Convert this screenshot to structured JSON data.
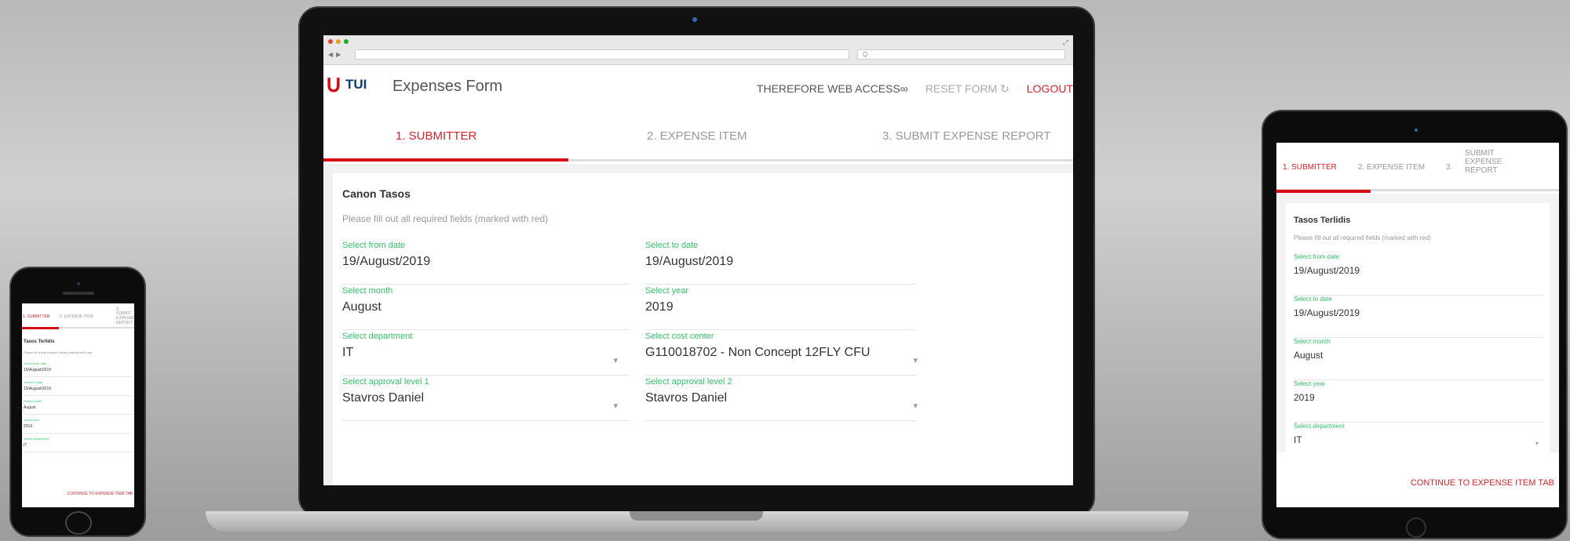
{
  "app": {
    "logo_text": "TUI",
    "title": "Expenses Form"
  },
  "header_links": {
    "web_access": "THEREFORE WEB ACCESS",
    "reset_form": "RESET FORM",
    "logout": "LOGOUT"
  },
  "browser": {
    "search_placeholder": "Q"
  },
  "steps": [
    {
      "label": "1. SUBMITTER",
      "active": true
    },
    {
      "label": "2. EXPENSE ITEM",
      "active": false
    },
    {
      "label": "3. SUBMIT EXPENSE REPORT",
      "active": false
    }
  ],
  "laptop_form": {
    "submitter_name": "Canon Tasos",
    "instructions": "Please fill out all required fields (marked with red)",
    "fields": [
      {
        "label": "Select from date",
        "value": "19/August/2019"
      },
      {
        "label": "Select to date",
        "value": "19/August/2019"
      },
      {
        "label": "Select month",
        "value": "August"
      },
      {
        "label": "Select year",
        "value": "2019"
      },
      {
        "label": "Select department",
        "value": "IT"
      },
      {
        "label": "Select cost center",
        "value": "G110018702 - Non Concept 12FLY CFU"
      },
      {
        "label": "Select approval level 1",
        "value": "Stavros Daniel"
      },
      {
        "label": "Select approval level 2",
        "value": "Stavros Daniel"
      }
    ]
  },
  "tablet_form": {
    "step1": "1. SUBMITTER",
    "step2": "2. EXPENSE ITEM",
    "step3_num": "3.",
    "step3_label": "SUBMIT EXPENSE REPORT",
    "submitter_name": "Tasos Terlidis",
    "instructions": "Please fill out all required fields (marked with red)",
    "fields": [
      {
        "label": "Select from date",
        "value": "19/August/2019"
      },
      {
        "label": "Select to date",
        "value": "19/August/2019"
      },
      {
        "label": "Select month",
        "value": "August"
      },
      {
        "label": "Select year",
        "value": "2019"
      },
      {
        "label": "Select department",
        "value": "IT"
      }
    ],
    "continue_button": "CONTINUE TO EXPENSE ITEM TAB"
  },
  "phone_form": {
    "step1": "1. SUBMITTER",
    "step2": "2. EXPENSE ITEM",
    "step3": "3. SUBMIT EXPENSE REPORT",
    "submitter_name": "Tasos Terlidis",
    "instructions": "Please fill out all required fields (marked with red)",
    "fields": [
      {
        "label": "Select from date",
        "value": "19/August/2019"
      },
      {
        "label": "Select to date",
        "value": "19/August/2019"
      },
      {
        "label": "Select month",
        "value": "August"
      },
      {
        "label": "Select year",
        "value": "2019"
      },
      {
        "label": "Select department",
        "value": "IT"
      }
    ],
    "continue_button": "CONTINUE TO EXPENSE ITEM TAB"
  },
  "colors": {
    "brand_red": "#d40e14",
    "label_green": "#35c26a",
    "brand_navy": "#0a3c6e"
  }
}
